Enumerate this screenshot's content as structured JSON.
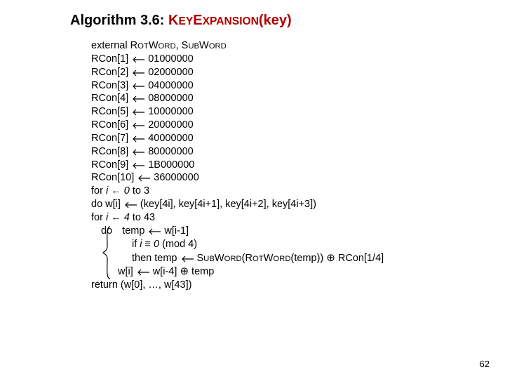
{
  "title": {
    "prefix": "Algorithm 3.6: ",
    "func_pre": "K",
    "func_mid1": "EY",
    "func_mid2": "E",
    "func_mid3": "XPANSION",
    "arg": "(key)"
  },
  "external_prefix": "external ",
  "rot_pre": "R",
  "rot_mid": "OT",
  "rot_w": "W",
  "rot_suf": "ORD",
  "sub_pre": "S",
  "sub_mid": "UB",
  "sub_w": "W",
  "sub_suf": "ORD",
  "rcon": [
    {
      "lhs": "RCon[1]",
      "rhs": "01000000"
    },
    {
      "lhs": "RCon[2]",
      "rhs": "02000000"
    },
    {
      "lhs": "RCon[3]",
      "rhs": "04000000"
    },
    {
      "lhs": "RCon[4]",
      "rhs": "08000000"
    },
    {
      "lhs": "RCon[5]",
      "rhs": "10000000"
    },
    {
      "lhs": "RCon[6]",
      "rhs": "20000000"
    },
    {
      "lhs": "RCon[7]",
      "rhs": "40000000"
    },
    {
      "lhs": "RCon[8]",
      "rhs": "80000000"
    },
    {
      "lhs": "RCon[9]",
      "rhs": "1B000000"
    },
    {
      "lhs": "RCon[10]",
      "rhs": "36000000"
    }
  ],
  "loop1": {
    "for_a": "for ",
    "for_b": "i ← 0",
    "for_c": " to 3",
    "do": " do w[i]",
    "rhs": "(key[4i], key[4i+1], key[4i+2], key[4i+3])"
  },
  "loop2": {
    "for_a": "for ",
    "for_b": "i ← 4",
    "for_c": " to 43",
    "do": " do ",
    "l1_lhs": "temp",
    "l1_rhs": "w[i-1]",
    "l2_if": "if  ",
    "l2_cond": "i ≡ 0",
    "l2_cond2": " (mod 4)",
    "l3_then": "  then temp",
    "l3_rhs_tail": "(temp))",
    "l3_rcon": "RCon[1/4]",
    "l4_lhs": "w[i]",
    "l4_rhs": "w[i-4]",
    "l4_rhs2": "temp"
  },
  "return_a": "return (",
  "return_b": "w[0], …, w[43]",
  "return_c": ")",
  "pagenum": "62"
}
